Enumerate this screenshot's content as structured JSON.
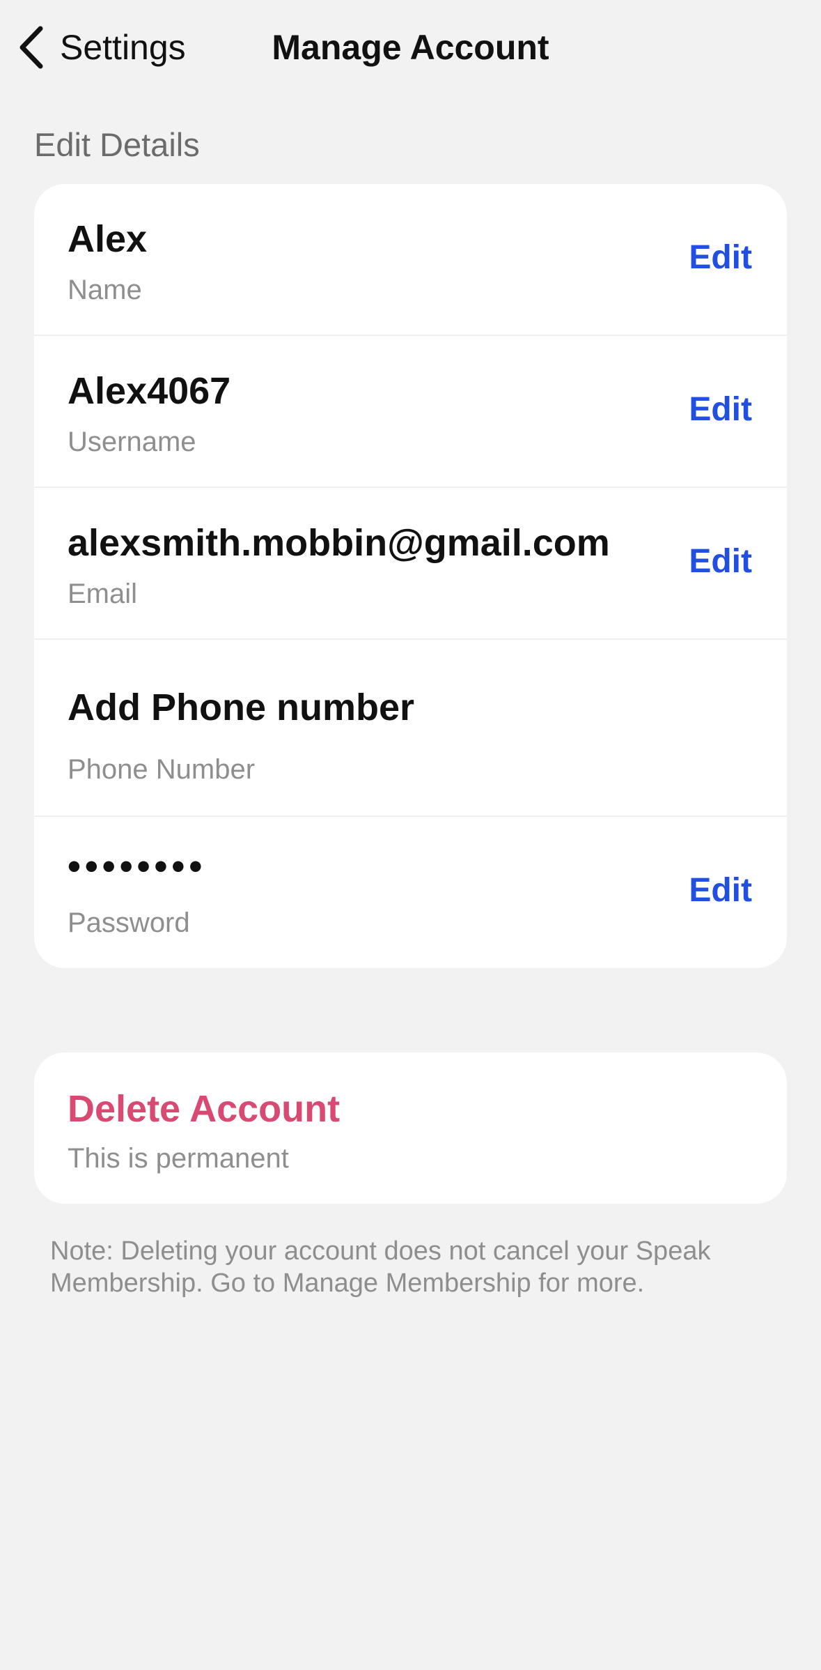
{
  "nav": {
    "back_label": "Settings",
    "title": "Manage Account"
  },
  "section": {
    "header": "Edit Details"
  },
  "details": {
    "name": {
      "value": "Alex",
      "label": "Name",
      "action": "Edit"
    },
    "username": {
      "value": "Alex4067",
      "label": "Username",
      "action": "Edit"
    },
    "email": {
      "value": "alexsmith.mobbin@gmail.com",
      "label": "Email",
      "action": "Edit"
    },
    "phone": {
      "value": "Add Phone number",
      "label": "Phone Number"
    },
    "password": {
      "value": "••••••••",
      "label": "Password",
      "action": "Edit"
    }
  },
  "delete": {
    "title": "Delete Account",
    "subtitle": "This is permanent"
  },
  "note": "Note: Deleting your account does not cancel your Speak Membership. Go to Manage Membership for more.",
  "colors": {
    "accent": "#2150e0",
    "destructive": "#d94a72",
    "background": "#f2f2f2"
  },
  "icons": {
    "back": "chevron-left-icon"
  }
}
